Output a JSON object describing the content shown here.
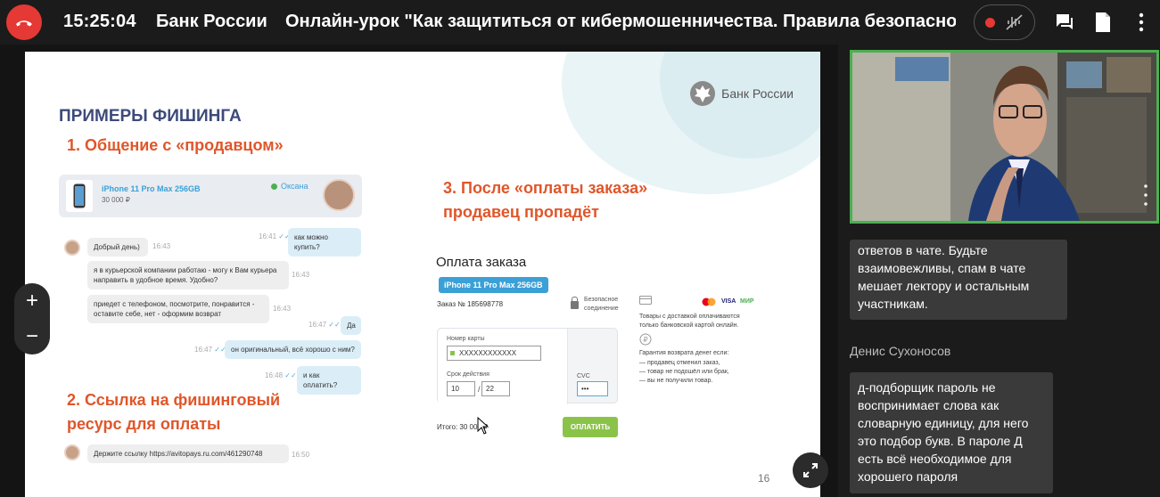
{
  "header": {
    "time": "15:25:04",
    "org": "Банк России",
    "title": "Онлайн-урок \"Как защититься от кибермошенничества. Правила безопаснос"
  },
  "slide": {
    "logo_text": "Банк России",
    "heading": "ПРИМЕРЫ ФИШИНГА",
    "section1": "1. Общение с «продавцом»",
    "section2_line1": "2. Ссылка на фишинговый",
    "section2_line2": "ресурс для оплаты",
    "section3_line1": "3. После «оплаты заказа»",
    "section3_line2": "продавец пропадёт",
    "product": {
      "name": "iPhone 11 Pro Max 256GB",
      "price": "30 000 ₽",
      "seller": "Оксана"
    },
    "chat": [
      {
        "text": "как можно купить?",
        "time": "16:41"
      },
      {
        "text": "Добрый день)",
        "time": "16:43"
      },
      {
        "text": "я в курьерской компании работаю - могу к Вам курьера направить в удобное время. Удобно?",
        "time": "16:43"
      },
      {
        "text": "приедет с телефоном, посмотрите, понравится - оставите себе, нет - оформим возврат",
        "time": "16:43"
      },
      {
        "text": "Да",
        "time": "16:47"
      },
      {
        "text": "он оригинальный, всё хорошо с ним?",
        "time": "16:47"
      },
      {
        "text": "и как оплатить?",
        "time": "16:48"
      },
      {
        "text": "Держите ссылку https://avitopays.ru.com/461290748",
        "time": "16:50"
      }
    ],
    "payment": {
      "title": "Оплата заказа",
      "badge": "iPhone 11 Pro Max 256GB",
      "order": "Заказ № 185698778",
      "secure": "Безопасное соединение",
      "card_label": "Номер карты",
      "card_value": "XXXXXXXXXXXX",
      "expiry_label": "Срок действия",
      "month": "10",
      "year": "22",
      "cvc_label": "CVC",
      "cvc_value": "•••",
      "total": "Итого: 30 000 ₽",
      "pay_button": "ОПЛАТИТЬ",
      "info1": "Товары с доставкой оплачиваются только банковской картой онлайн.",
      "guarantee_title": "Гарантия возврата денег если:",
      "g1": "— продавец отменил заказ,",
      "g2": "— товар не подошёл или брак,",
      "g3": "— вы не получили товар.",
      "visa": "VISA",
      "mir": "МИР"
    },
    "page_number": "16"
  },
  "chat_panel": {
    "msg1": "ответов в чате. Будьте взаимовежливы, спам в чате мешает лектору и остальным участникам.",
    "author": "Денис Сухоносов",
    "msg2": "д-подборщик пароль не воспринимает слова как словарную единицу, для него это подбор букв. В пароле Д есть всё необходимое для хорошего пароля"
  },
  "controls": {
    "zoom_in": "+",
    "zoom_out": "−"
  },
  "colors": {
    "accent_red": "#e53935",
    "slide_heading": "#3d4a7a",
    "slide_orange": "#e0562a",
    "video_border": "#4caf50",
    "pay_green": "#8bc34a"
  }
}
